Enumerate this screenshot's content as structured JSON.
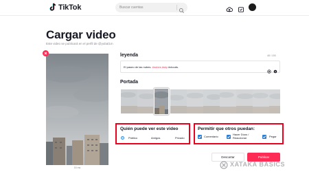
{
  "header": {
    "brand": "TikTok",
    "search_placeholder": "Buscar cuentas"
  },
  "page": {
    "title": "Cargar video",
    "subtitle": "Este video se publicará en el perfil de @yubal1m"
  },
  "caption": {
    "label": "leyenda",
    "counter": "48 / 150",
    "text": "El paseo de las nubes. ",
    "hashtags": "#nubes #sky",
    "text_end": " #clouds."
  },
  "cover": {
    "label": "Portada"
  },
  "privacy": {
    "title": "Quién puede ver este video",
    "options": [
      "Público",
      "Amigos",
      "Privado"
    ],
    "selected": "Público"
  },
  "permissions": {
    "title": "Permitir que otros puedan:",
    "options": [
      {
        "label": "Comentario",
        "checked": true
      },
      {
        "label_line1": "Hacer Dúos /",
        "label_line2": "Reaccionar",
        "checked": true
      },
      {
        "label": "Pegar",
        "checked": true
      }
    ]
  },
  "buttons": {
    "discard": "Descartar",
    "publish": "Publicar"
  },
  "preview": {
    "caption": "15 ms"
  },
  "watermark": {
    "text": "XATAKA BASICS"
  },
  "colors": {
    "accent": "#fe2c55",
    "highlight_border": "#e8001c",
    "checkbox": "#2d7cd6"
  }
}
